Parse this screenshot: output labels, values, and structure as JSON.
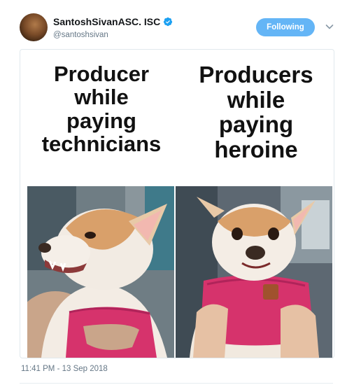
{
  "author": {
    "display_name": "SantoshSivanASC. ISC",
    "handle": "@santoshsivan",
    "verified": true
  },
  "follow_button": {
    "label": "Following"
  },
  "meme": {
    "left_caption": "Producer\nwhile\npaying\ntechnicians",
    "right_caption": "Producers\nwhile\npaying\nheroine"
  },
  "timestamp": "11:41 PM - 13 Sep 2018",
  "colors": {
    "accent": "#1da1f2",
    "follow_bg": "#64b5f6",
    "secondary_text": "#657786"
  },
  "icons": {
    "verified": "verified-badge-icon",
    "menu": "chevron-down-icon"
  }
}
